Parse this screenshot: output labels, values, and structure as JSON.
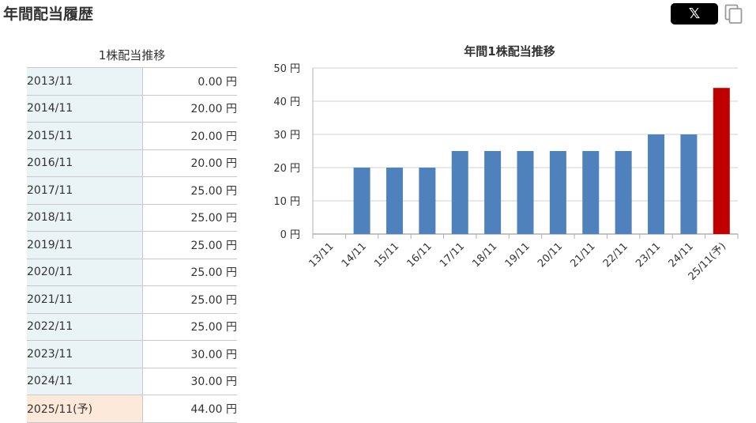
{
  "page": {
    "title": "年間配当履歴"
  },
  "share": {
    "x_label": "𝕏",
    "x_icon": "x-logo-icon",
    "copy_icon": "copy-icon"
  },
  "table": {
    "caption": "1株配当推移",
    "rows": [
      {
        "year": "2013/11",
        "amount": "0.00 円"
      },
      {
        "year": "2014/11",
        "amount": "20.00 円"
      },
      {
        "year": "2015/11",
        "amount": "20.00 円"
      },
      {
        "year": "2016/11",
        "amount": "20.00 円"
      },
      {
        "year": "2017/11",
        "amount": "25.00 円"
      },
      {
        "year": "2018/11",
        "amount": "25.00 円"
      },
      {
        "year": "2019/11",
        "amount": "25.00 円"
      },
      {
        "year": "2020/11",
        "amount": "25.00 円"
      },
      {
        "year": "2021/11",
        "amount": "25.00 円"
      },
      {
        "year": "2022/11",
        "amount": "25.00 円"
      },
      {
        "year": "2023/11",
        "amount": "30.00 円"
      },
      {
        "year": "2024/11",
        "amount": "30.00 円"
      },
      {
        "year": "2025/11(予)",
        "amount": "44.00 円",
        "forecast": true
      }
    ]
  },
  "chart_data": {
    "type": "bar",
    "title": "年間1株配当推移",
    "categories": [
      "13/11",
      "14/11",
      "15/11",
      "16/11",
      "17/11",
      "18/11",
      "19/11",
      "20/11",
      "21/11",
      "22/11",
      "23/11",
      "24/11",
      "25/11(予)"
    ],
    "values": [
      0,
      20,
      20,
      20,
      25,
      25,
      25,
      25,
      25,
      25,
      30,
      30,
      44
    ],
    "ylim": [
      0,
      50
    ],
    "yticks": [
      0,
      10,
      20,
      30,
      40,
      50
    ],
    "ytick_labels": [
      "0 円",
      "10 円",
      "20 円",
      "30 円",
      "40 円",
      "50 円"
    ],
    "grid": true,
    "legend": "none",
    "colors": {
      "actual": "#4f81bd",
      "forecast": "#c00000",
      "grid": "#d0d0d0",
      "axis": "#b0b0b0"
    },
    "forecast_index": 12
  }
}
